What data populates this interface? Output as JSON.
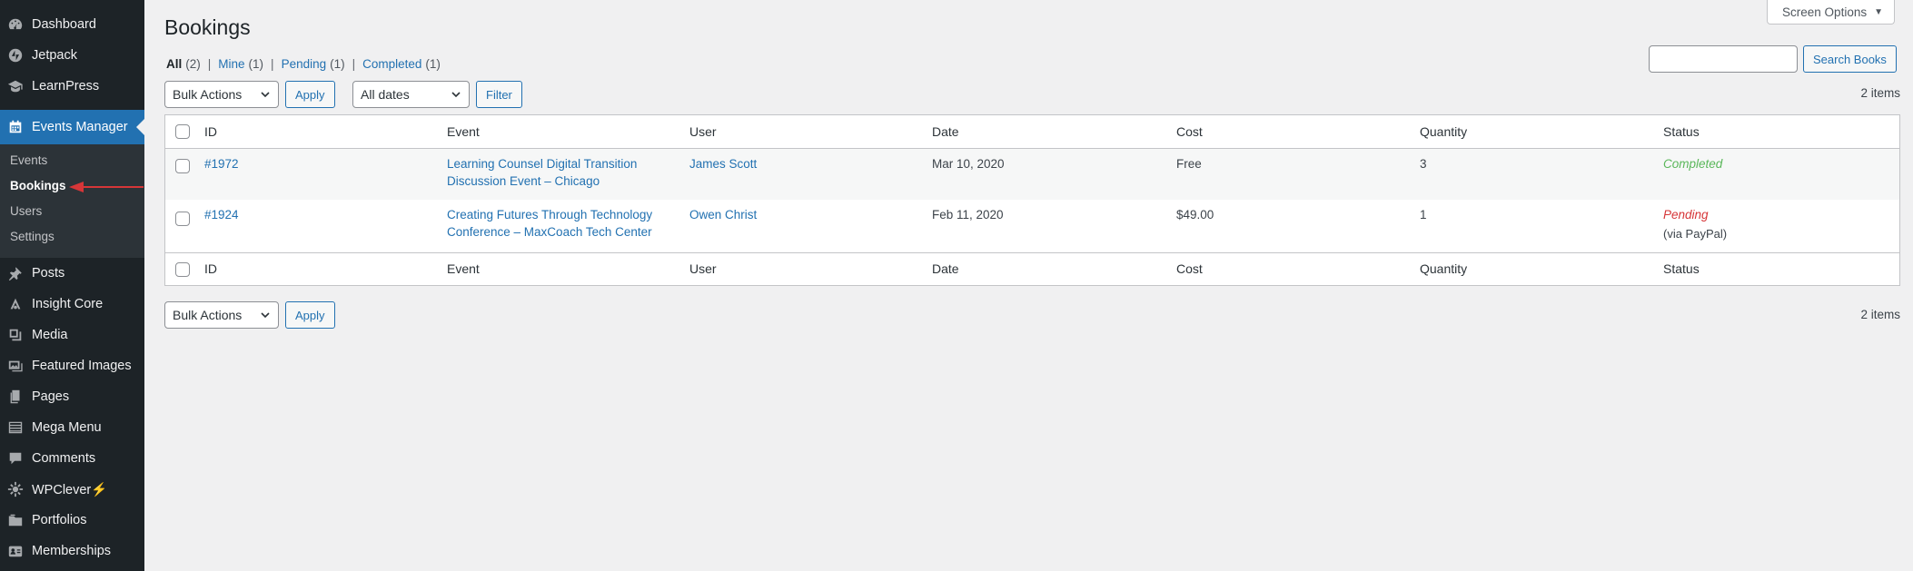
{
  "sidebar": {
    "items": [
      {
        "label": "Dashboard",
        "icon": "dashboard-icon"
      },
      {
        "label": "Jetpack",
        "icon": "jetpack-icon"
      },
      {
        "label": "LearnPress",
        "icon": "learnpress-icon"
      },
      {
        "label": "Events Manager",
        "icon": "calendar-icon"
      },
      {
        "label": "Posts",
        "icon": "pushpin-icon"
      },
      {
        "label": "Insight Core",
        "icon": "insight-core-icon"
      },
      {
        "label": "Media",
        "icon": "media-icon"
      },
      {
        "label": "Featured Images",
        "icon": "featured-images-icon"
      },
      {
        "label": "Pages",
        "icon": "pages-icon"
      },
      {
        "label": "Mega Menu",
        "icon": "mega-menu-icon"
      },
      {
        "label": "Comments",
        "icon": "comments-icon"
      },
      {
        "label": "WPClever",
        "icon": "wpclever-icon",
        "badge": "⚡"
      },
      {
        "label": "Portfolios",
        "icon": "portfolio-icon"
      },
      {
        "label": "Memberships",
        "icon": "memberships-icon"
      }
    ],
    "submenu": [
      {
        "label": "Events"
      },
      {
        "label": "Bookings"
      },
      {
        "label": "Users"
      },
      {
        "label": "Settings"
      }
    ],
    "colors": {
      "background": "#1d2327",
      "active": "#2271b1",
      "annotation_arrow": "#d63638"
    }
  },
  "page": {
    "title": "Bookings",
    "screen_options": "Screen Options",
    "filters": [
      {
        "label": "All",
        "count": "(2)"
      },
      {
        "label": "Mine",
        "count": "(1)"
      },
      {
        "label": "Pending",
        "count": "(1)"
      },
      {
        "label": "Completed",
        "count": "(1)"
      }
    ],
    "filter_sep": "|",
    "search_button": "Search Books",
    "bulk_actions": "Bulk Actions",
    "apply": "Apply",
    "dates_select": "All dates",
    "filter_button": "Filter",
    "items_count": "2 items"
  },
  "table": {
    "columns": [
      "ID",
      "Event",
      "User",
      "Date",
      "Cost",
      "Quantity",
      "Status"
    ],
    "rows": [
      {
        "id": "#1972",
        "event_line1": "Learning Counsel Digital Transition",
        "event_line2": "Discussion Event – Chicago",
        "user": "James Scott",
        "date": "Mar 10, 2020",
        "cost": "Free",
        "quantity": "3",
        "status": "Completed",
        "status_note": ""
      },
      {
        "id": "#1924",
        "event_line1": "Creating Futures Through Technology",
        "event_line2": "Conference – MaxCoach Tech Center",
        "user": "Owen Christ",
        "date": "Feb 11, 2020",
        "cost": "$49.00",
        "quantity": "1",
        "status": "Pending",
        "status_note": "(via PayPal)"
      }
    ],
    "status_colors": {
      "completed": "#5ab75a",
      "pending": "#d63638"
    }
  }
}
